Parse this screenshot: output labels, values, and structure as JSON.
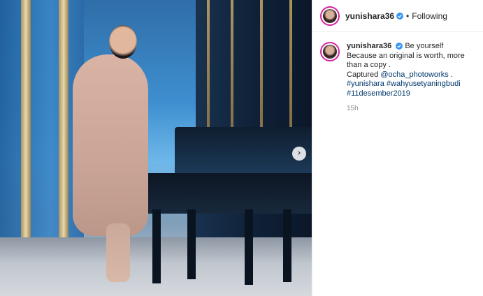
{
  "post": {
    "image_alt": "Photo by yunishara36",
    "next_icon": "chevron-right-icon"
  },
  "header": {
    "username": "yunishara36",
    "verified": true,
    "separator": "•",
    "follow_status": "Following"
  },
  "caption": {
    "username": "yunishara36",
    "line1": "Be yourself",
    "line2": "Because an original is worth, more than a copy .",
    "line3_prefix": "Captured ",
    "mention": "@ocha_photoworks",
    "line3_suffix": " .",
    "hashtag1": "#yunishara",
    "hashtag2": "#wahyusetyaningbudi",
    "hashtag3": "#11desember2019",
    "time": "15h"
  },
  "colors": {
    "verified_blue": "#3897f0",
    "link": "#00376b",
    "muted": "#8e8e8e",
    "story_ring": "#d6249f"
  }
}
